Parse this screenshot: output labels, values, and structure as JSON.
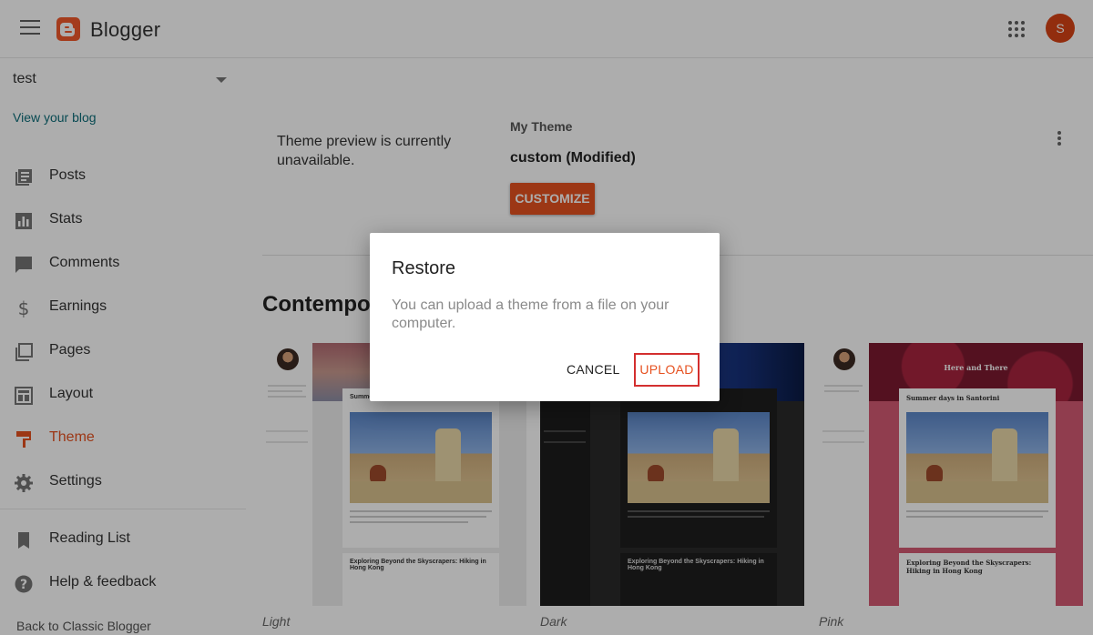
{
  "app": {
    "brand": "Blogger"
  },
  "user": {
    "avatar_letter": "S"
  },
  "sidebar": {
    "blog_name": "test",
    "view_blog": "View your blog",
    "items": [
      {
        "label": "Posts",
        "icon": "posts-icon"
      },
      {
        "label": "Stats",
        "icon": "stats-icon"
      },
      {
        "label": "Comments",
        "icon": "comments-icon"
      },
      {
        "label": "Earnings",
        "icon": "dollar-icon"
      },
      {
        "label": "Pages",
        "icon": "pages-icon"
      },
      {
        "label": "Layout",
        "icon": "layout-icon"
      },
      {
        "label": "Theme",
        "icon": "theme-icon",
        "active": true
      },
      {
        "label": "Settings",
        "icon": "gear-icon"
      }
    ],
    "secondary": [
      {
        "label": "Reading List",
        "icon": "bookmark-icon"
      },
      {
        "label": "Help & feedback",
        "icon": "help-icon"
      }
    ],
    "classic_link": "Back to Classic Blogger"
  },
  "main": {
    "preview_unavailable": "Theme preview is currently unavailable.",
    "my_theme_label": "My Theme",
    "theme_name": "custom (Modified)",
    "customize_button": "CUSTOMIZE",
    "section_title": "Contempo",
    "themes": [
      {
        "name": "Light"
      },
      {
        "name": "Dark"
      },
      {
        "name": "Pink",
        "header_text": "Here and There"
      }
    ],
    "sample_posts": {
      "first": "Summer days in Santorini",
      "second": "Exploring Beyond the Skyscrapers: Hiking in Hong Kong"
    }
  },
  "dialog": {
    "title": "Restore",
    "text": "You can upload a theme from a file on your computer.",
    "cancel": "CANCEL",
    "upload": "UPLOAD"
  },
  "colors": {
    "accent": "#e65120",
    "highlight_border": "#d32f2f",
    "link": "#0d6e7a"
  }
}
